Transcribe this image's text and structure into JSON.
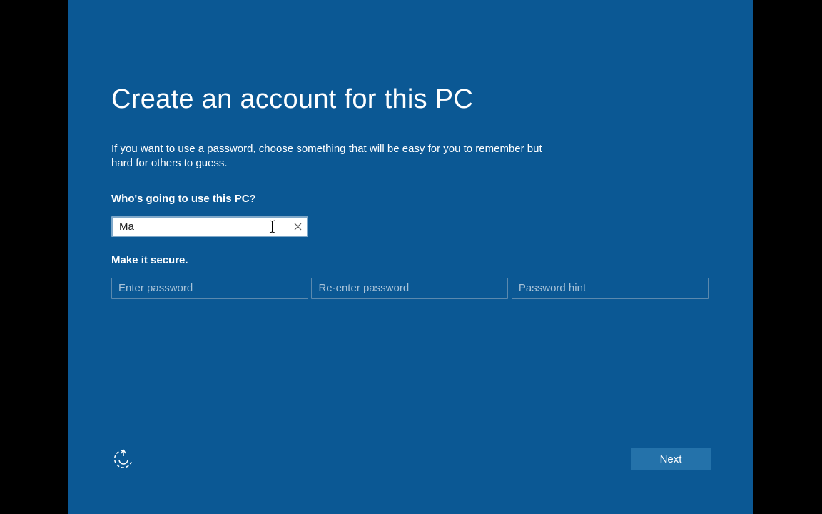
{
  "title": "Create an account for this PC",
  "description": "If you want to use a password, choose something that will be easy for you to remember but hard for others to guess.",
  "section1_label": "Who's going to use this PC?",
  "username_value": "Ma",
  "section2_label": "Make it secure.",
  "password_placeholder": "Enter password",
  "reenter_placeholder": "Re-enter password",
  "hint_placeholder": "Password hint",
  "next_label": "Next"
}
